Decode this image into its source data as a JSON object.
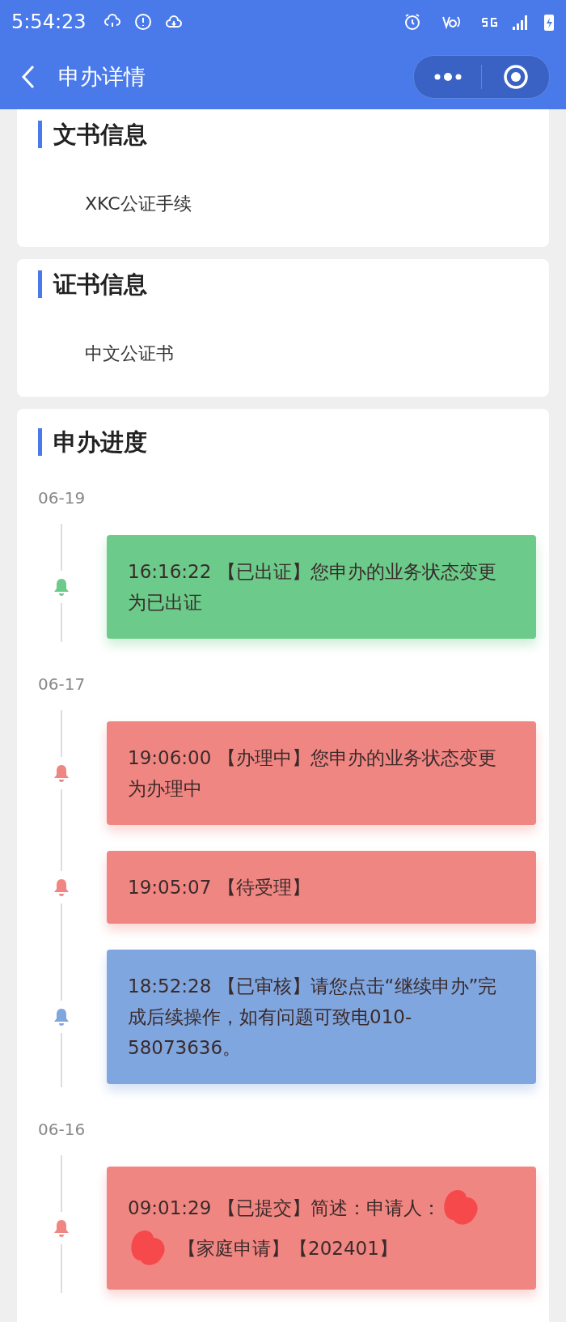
{
  "status_bar": {
    "time": "5:54:23"
  },
  "nav": {
    "title": "申办详情"
  },
  "sections": [
    {
      "title": "文书信息",
      "value": "XKC公证手续"
    },
    {
      "title": "证书信息",
      "value": "中文公证书"
    }
  ],
  "progress": {
    "title": "申办进度",
    "groups": [
      {
        "date": "06-19",
        "entries": [
          {
            "kind": "plain",
            "color": "#6ccb8a",
            "text": "16:16:22 【已出证】您申办的业务状态变更为已出证"
          }
        ]
      },
      {
        "date": "06-17",
        "entries": [
          {
            "kind": "plain",
            "color": "#f08682",
            "text": "19:06:00 【办理中】您申办的业务状态变更为办理中"
          },
          {
            "kind": "plain",
            "color": "#f08682",
            "text": "19:05:07 【待受理】"
          },
          {
            "kind": "plain",
            "color": "#80a6df",
            "text": "18:52:28 【已审核】请您点击“继续申办”完成后续操作，如有问题可致电010-58073636。"
          }
        ]
      },
      {
        "date": "06-16",
        "entries": [
          {
            "kind": "redacted",
            "color": "#f08682",
            "text": "09:01:29 【已提交】简述：申请人：",
            "text_2": "【家庭申请】【202401】"
          }
        ]
      }
    ]
  }
}
